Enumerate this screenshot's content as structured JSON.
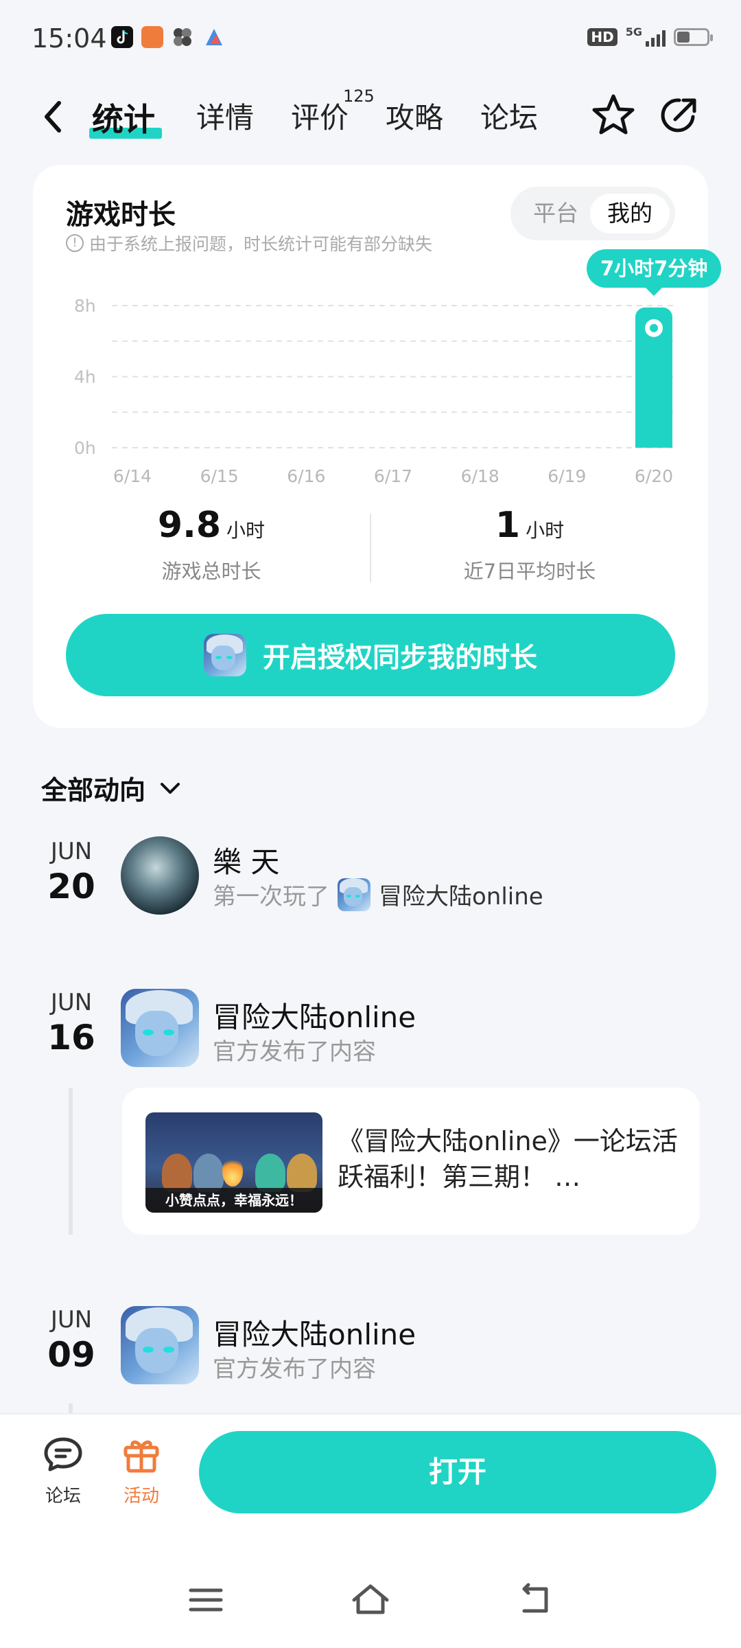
{
  "status_bar": {
    "time": "15:04",
    "hd": "HD",
    "network": "5G"
  },
  "nav": {
    "tabs": [
      {
        "label": "统计",
        "active": true
      },
      {
        "label": "详情"
      },
      {
        "label": "评价",
        "badge": "125"
      },
      {
        "label": "攻略"
      },
      {
        "label": "论坛"
      }
    ],
    "icons": [
      "back-arrow-icon",
      "star-icon",
      "share-icon"
    ]
  },
  "stats_card": {
    "title": "游戏时长",
    "note": "由于系统上报问题，时长统计可能有部分缺失",
    "toggle": {
      "options": [
        "平台",
        "我的"
      ],
      "selected": "我的"
    },
    "tooltip": "7小时7分钟",
    "total": {
      "value": "9.8",
      "unit": "小时",
      "label": "游戏总时长"
    },
    "average": {
      "value": "1",
      "unit": "小时",
      "label": "近7日平均时长"
    },
    "sync_button": "开启授权同步我的时长"
  },
  "chart_data": {
    "type": "bar",
    "categories": [
      "6/14",
      "6/15",
      "6/16",
      "6/17",
      "6/18",
      "6/19",
      "6/20"
    ],
    "values": [
      0,
      0,
      0,
      0,
      0,
      0,
      7.12
    ],
    "y_ticks": [
      "0h",
      "4h",
      "8h"
    ],
    "ylim": [
      0,
      8
    ],
    "grid": true,
    "color": "#1fd4c5"
  },
  "feed": {
    "header": "全部动向",
    "items": [
      {
        "month": "JUN",
        "day": "20",
        "name": "樂 天",
        "action": "第一次玩了",
        "game": "冒险大陆online"
      },
      {
        "month": "JUN",
        "day": "16",
        "name": "冒险大陆online",
        "action": "官方发布了内容",
        "post": {
          "title": "《冒险大陆online》一论坛活跃福利！第三期！ …",
          "thumb_caption": "小赞点点，幸福永远！"
        }
      },
      {
        "month": "JUN",
        "day": "09",
        "name": "冒险大陆online",
        "action": "官方发布了内容"
      }
    ]
  },
  "bottom_bar": {
    "forum_label": "论坛",
    "event_label": "活动",
    "open_button": "打开",
    "accent": "#1fd4c5",
    "event_color": "#f07c3c"
  }
}
